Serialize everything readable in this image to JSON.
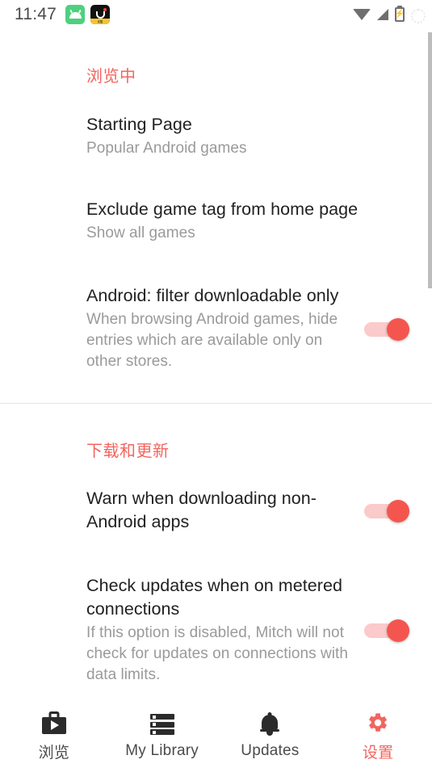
{
  "status_bar": {
    "clock": "11:47",
    "left_icons": [
      {
        "name": "android-app-icon",
        "label": ""
      },
      {
        "name": "app-notification-icon",
        "label": "优酷"
      }
    ],
    "right_icons": [
      "wifi-icon",
      "signal-icon",
      "battery-charging-icon"
    ]
  },
  "sections": [
    {
      "header": "浏览中",
      "rows": [
        {
          "title": "Starting Page",
          "subtitle": "Popular Android games",
          "control": "none"
        },
        {
          "title": "Exclude game tag from home page",
          "subtitle": "Show all games",
          "control": "none"
        },
        {
          "title": "Android: filter downloadable only",
          "subtitle": "When browsing Android games, hide entries which are available only on other stores.",
          "control": "toggle",
          "toggle_on": true
        }
      ]
    },
    {
      "header": "下载和更新",
      "rows": [
        {
          "title": "Warn when downloading non-Android apps",
          "subtitle": "",
          "control": "toggle",
          "toggle_on": true
        },
        {
          "title": "Check updates when on metered connections",
          "subtitle": "If this option is disabled, Mitch will not check for updates on connections with data limits.",
          "control": "toggle",
          "toggle_on": true
        }
      ]
    }
  ],
  "bottom_nav": [
    {
      "label": "浏览",
      "icon": "store-icon",
      "active": false
    },
    {
      "label": "My Library",
      "icon": "library-list-icon",
      "active": false
    },
    {
      "label": "Updates",
      "icon": "bell-icon",
      "active": false
    },
    {
      "label": "设置",
      "icon": "gear-icon",
      "active": true
    }
  ],
  "colors": {
    "accent": "#f2655f",
    "toggle_on_knob": "#f4564f",
    "toggle_on_track": "#fbcaca",
    "title_text": "#212121",
    "subtitle_text": "#9a9a9a",
    "divider": "#e3e3e3",
    "scrollbar": "#bdbdbd"
  }
}
